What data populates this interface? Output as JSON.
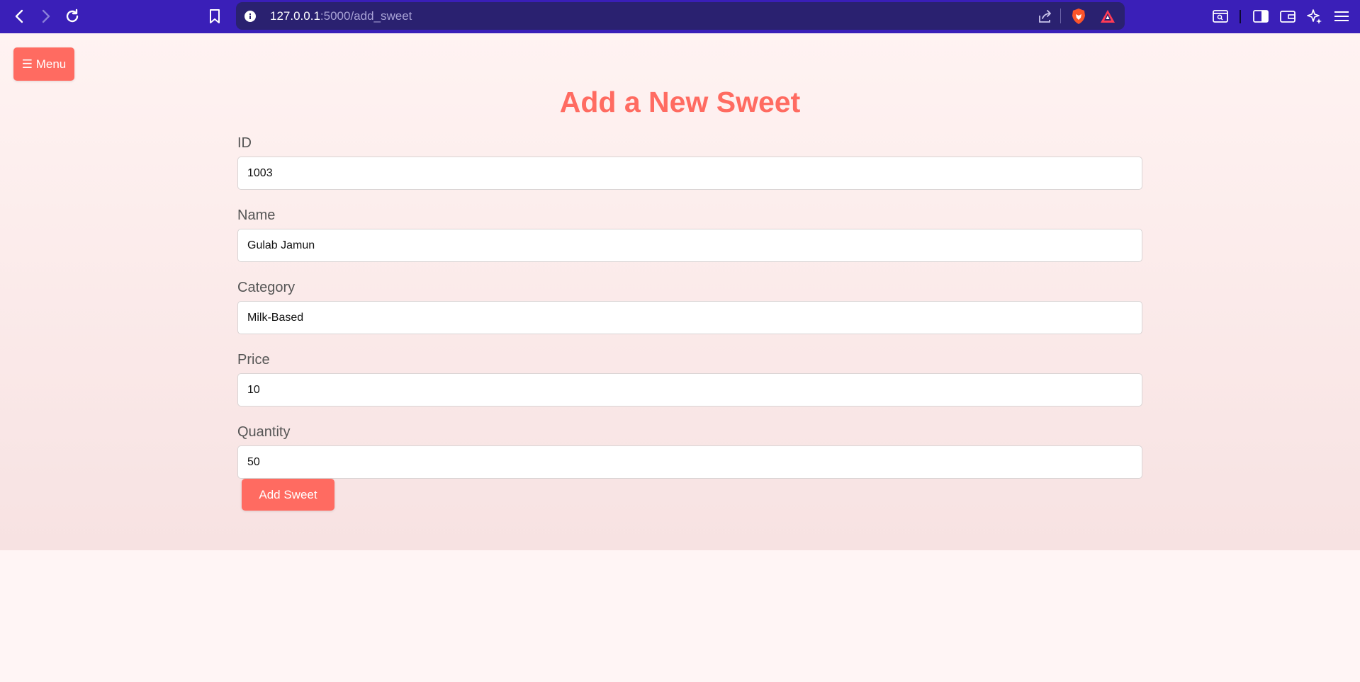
{
  "browser": {
    "url_host": "127.0.0.1",
    "url_path": ":5000/add_sweet",
    "toolbar_color": "#3a1fb8",
    "address_bar_color": "#2a2170"
  },
  "page": {
    "menu_label": "☰ Menu",
    "title": "Add a New Sweet",
    "accent_color": "#ff6b61"
  },
  "form": {
    "fields": [
      {
        "label": "ID",
        "value": "1003"
      },
      {
        "label": "Name",
        "value": "Gulab Jamun"
      },
      {
        "label": "Category",
        "value": "Milk-Based"
      },
      {
        "label": "Price",
        "value": "10"
      },
      {
        "label": "Quantity",
        "value": "50"
      }
    ],
    "submit_label": "Add Sweet"
  }
}
